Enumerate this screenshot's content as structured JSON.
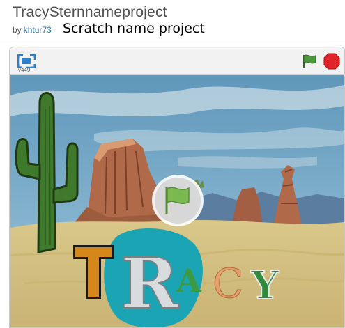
{
  "project": {
    "title": "TracySternnameproject",
    "by_label": "by",
    "author": "khtur73",
    "subtitle": "Scratch name project"
  },
  "player": {
    "version": "v449",
    "fullscreen_icon": "fullscreen-icon",
    "green_flag_icon": "green-flag-icon",
    "stop_icon": "stop-sign-icon",
    "play_overlay_icon": "green-flag-play-icon"
  },
  "stage": {
    "letters": [
      "T",
      "R",
      "A",
      "C",
      "Y"
    ],
    "scene": "desert with cactus and rock mesas"
  },
  "colors": {
    "author_link": "#2a7ab0",
    "flag_green": "#4d9a3c",
    "stop_red": "#e0252a",
    "fullscreen_blue": "#2d7fd0",
    "sky": "#6ea3c4",
    "sand": "#d8c98a",
    "teal_blob": "#1ba5b4"
  }
}
